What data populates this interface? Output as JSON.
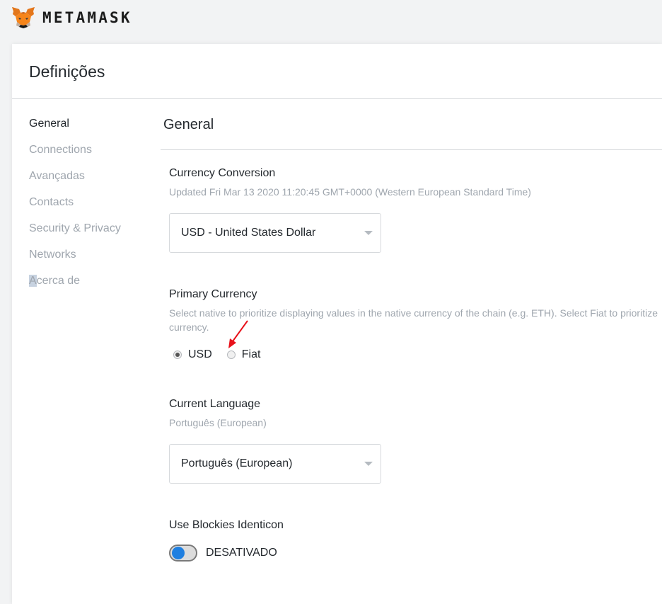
{
  "header": {
    "brand": "METAMASK",
    "logo_icon": "metamask-fox-icon"
  },
  "page": {
    "title": "Definições"
  },
  "sidebar": {
    "items": [
      {
        "label": "General",
        "active": true
      },
      {
        "label": "Connections",
        "active": false
      },
      {
        "label": "Avançadas",
        "active": false
      },
      {
        "label": "Contacts",
        "active": false
      },
      {
        "label": "Security & Privacy",
        "active": false
      },
      {
        "label": "Networks",
        "active": false
      },
      {
        "label_first": "A",
        "label_rest": "cerca de",
        "active": false
      }
    ]
  },
  "general": {
    "heading": "General",
    "currency_conversion": {
      "title": "Currency Conversion",
      "description": "Updated Fri Mar 13 2020 11:20:45 GMT+0000 (Western European Standard Time)",
      "selected": "USD - United States Dollar"
    },
    "primary_currency": {
      "title": "Primary Currency",
      "description_line1": "Select native to prioritize displaying values in the native currency of the chain (e.g. ETH). Select Fiat to prioritize",
      "description_line2": "currency.",
      "options": [
        {
          "label": "USD",
          "checked": true
        },
        {
          "label": "Fiat",
          "checked": false
        }
      ]
    },
    "current_language": {
      "title": "Current Language",
      "description": "Português (European)",
      "selected": "Português (European)"
    },
    "blockies": {
      "title": "Use Blockies Identicon",
      "toggle_label": "DESATIVADO",
      "enabled": false
    }
  },
  "colors": {
    "accent_blue": "#1f7fe0",
    "annotation_red": "#e8121b",
    "muted_text": "#9fa6ae"
  }
}
